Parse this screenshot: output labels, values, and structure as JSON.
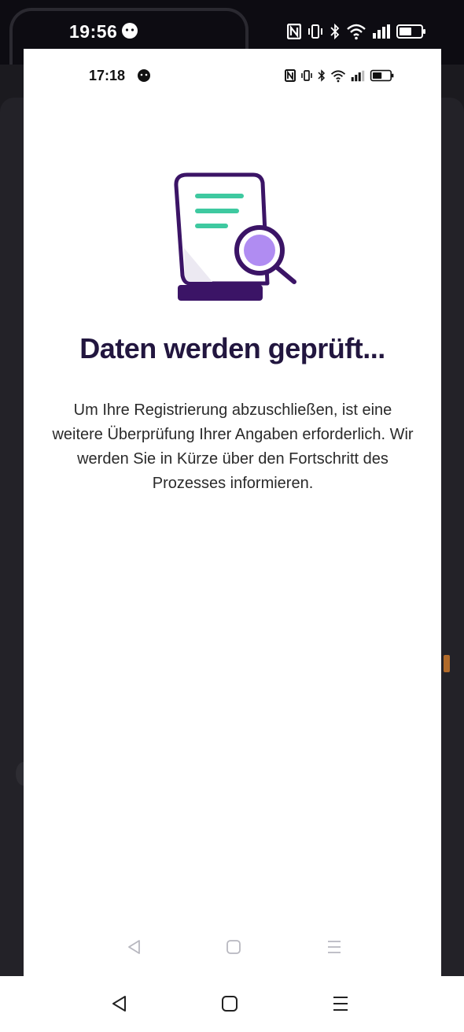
{
  "outer_status": {
    "time": "19:56"
  },
  "inner_status": {
    "time": "17:18"
  },
  "content": {
    "title": "Daten werden geprüft...",
    "body": "Um Ihre Registrierung abzuschließen, ist eine weitere Überprüfung Ihrer Angaben erforderlich. Wir werden Sie in Kürze über den Fortschritt des Prozesses informieren."
  },
  "icons": {
    "illustration": "document-search-illustration",
    "nav_back": "back-triangle-icon",
    "nav_home": "home-square-icon",
    "nav_menu": "menu-lines-icon"
  },
  "colors": {
    "title": "#22163f",
    "illustration_outline": "#3b1466",
    "illustration_lines": "#3ec9a0",
    "illustration_lens": "#b08cf2"
  }
}
